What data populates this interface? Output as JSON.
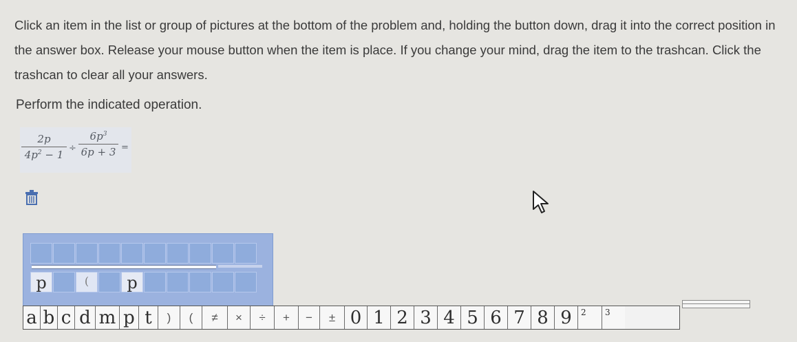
{
  "instructions": "Click an item in the list or group of pictures at the bottom of the problem and, holding the button down, drag it into the correct position in the answer box. Release your mouse button when the item is place. If you change your mind, drag the item to the trashcan. Click the trashcan to clear all your answers.",
  "prompt": "Perform the indicated operation.",
  "expression": {
    "frac1_num": "2p",
    "frac1_den_a": "4p",
    "frac1_den_exp": "2",
    "frac1_den_b": " − 1",
    "divide": "÷",
    "frac2_num_a": "6p",
    "frac2_num_exp": "3",
    "frac2_den": "6p + 3",
    "equals": "="
  },
  "icons": {
    "trash": "trash-icon",
    "cursor": "mouse-pointer-icon"
  },
  "answer_box": {
    "top_cells": [
      "",
      "",
      "",
      "",
      "",
      "",
      "",
      "",
      "",
      ""
    ],
    "bottom_cells": [
      "p",
      "",
      "(",
      "",
      "p",
      "",
      "",
      "",
      "",
      ""
    ]
  },
  "palette": {
    "letters": [
      "a",
      "b",
      "c",
      "d",
      "m",
      "p",
      "t"
    ],
    "symbols": [
      ")",
      "(",
      "≠",
      "×",
      "÷",
      "+",
      "−",
      "±"
    ],
    "digits": [
      "0",
      "1",
      "2",
      "3",
      "4",
      "5",
      "6",
      "7",
      "8",
      "9"
    ],
    "exponents": [
      "2",
      "3"
    ]
  },
  "colors": {
    "answer_box_bg": "#9bb2df",
    "answer_cell": "#8facdc",
    "page_bg": "#e6e5e1"
  }
}
